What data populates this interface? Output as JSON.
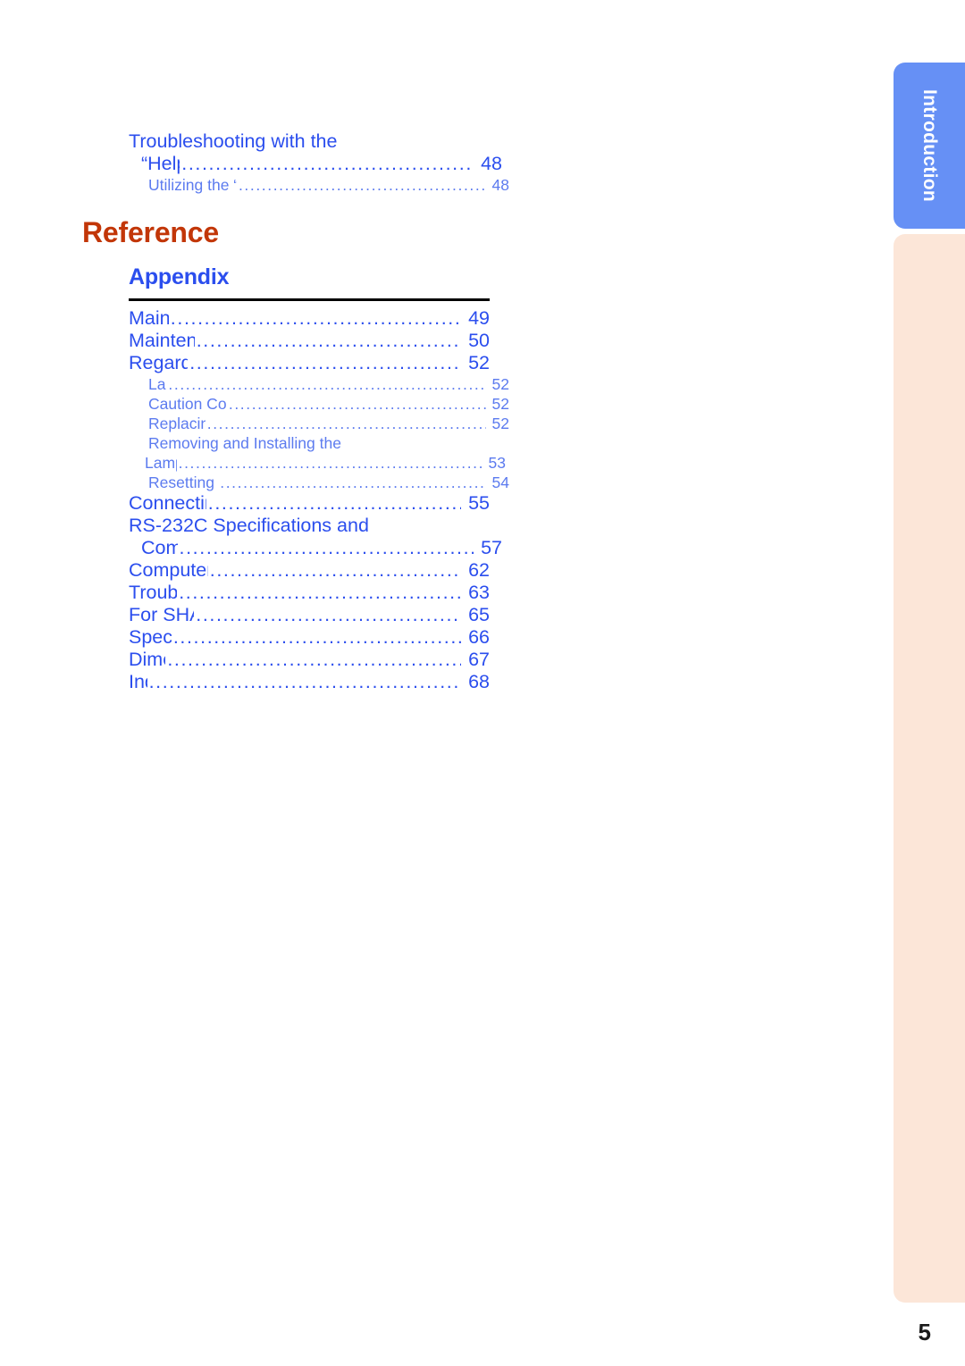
{
  "page": {
    "number": "5",
    "background_color": "#ffffff"
  },
  "side_tabs": [
    {
      "label": "Introduction",
      "color": "#6690F5",
      "text_color": "#ffffff",
      "active": true
    },
    {
      "label": "",
      "color": "#FCE6D8",
      "text_color": "#FCE6D8",
      "active": false
    }
  ],
  "top_block": {
    "entries": [
      {
        "level": 1,
        "lines": [
          "Troubleshooting with the",
          "“Help” Menu"
        ],
        "page": "48"
      },
      {
        "level": 2,
        "lines": [
          "Utilizing the “Help” Menu Functions"
        ],
        "page": "48"
      }
    ]
  },
  "part_heading": {
    "label": "Reference",
    "color": "#C23608"
  },
  "chapter_heading": {
    "label": "Appendix",
    "color": "#2B4EEE"
  },
  "appendix_entries": [
    {
      "level": 1,
      "lines": [
        "Maintenance"
      ],
      "page": "49"
    },
    {
      "level": 1,
      "lines": [
        "Maintenance Indicators"
      ],
      "page": "50"
    },
    {
      "level": 1,
      "lines": [
        "Regarding the Lamp"
      ],
      "page": "52"
    },
    {
      "level": 2,
      "lines": [
        "Lamp"
      ],
      "page": "52"
    },
    {
      "level": 2,
      "lines": [
        "Caution Concerning the Lamp"
      ],
      "page": "52"
    },
    {
      "level": 2,
      "lines": [
        "Replacing the Lamp"
      ],
      "page": "52"
    },
    {
      "level": 2,
      "lines": [
        "Removing and Installing the",
        "Lamp Unit"
      ],
      "page": "53"
    },
    {
      "level": 2,
      "lines": [
        "Resetting the Lamp Timer"
      ],
      "page": "54"
    },
    {
      "level": 1,
      "lines": [
        "Connecting Pin Assignments"
      ],
      "page": "55"
    },
    {
      "level": 1,
      "lines": [
        "RS-232C Specifications and",
        "Commands"
      ],
      "page": "57"
    },
    {
      "level": 1,
      "lines": [
        "Computer Compatibility Chart"
      ],
      "page": "62"
    },
    {
      "level": 1,
      "lines": [
        "Troubleshooting"
      ],
      "page": "63"
    },
    {
      "level": 1,
      "lines": [
        "For SHARP Assistance"
      ],
      "page": "65"
    },
    {
      "level": 1,
      "lines": [
        "Specifications"
      ],
      "page": "66"
    },
    {
      "level": 1,
      "lines": [
        "Dimensions"
      ],
      "page": "67"
    },
    {
      "level": 1,
      "lines": [
        "Index"
      ],
      "page": "68"
    }
  ]
}
